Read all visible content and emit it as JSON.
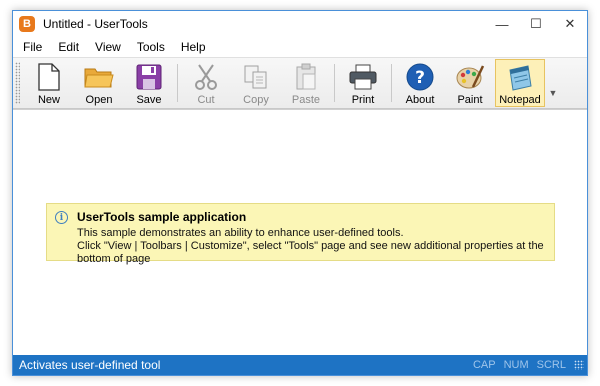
{
  "window": {
    "title": "Untitled - UserTools",
    "app_icon_letter": "B",
    "controls": {
      "minimize": "—",
      "maximize": "☐",
      "close": "✕"
    }
  },
  "menu": [
    "File",
    "Edit",
    "View",
    "Tools",
    "Help"
  ],
  "toolbar": {
    "new_label": "New",
    "open_label": "Open",
    "save_label": "Save",
    "cut_label": "Cut",
    "copy_label": "Copy",
    "paste_label": "Paste",
    "print_label": "Print",
    "about_label": "About",
    "paint_label": "Paint",
    "notepad_label": "Notepad",
    "active_item": "Notepad",
    "disabled_items": [
      "Cut",
      "Copy",
      "Paste"
    ]
  },
  "info": {
    "title": "UserTools sample application",
    "line1": "This sample demonstrates an ability to enhance user-defined tools.",
    "line2": "Click \"View | Toolbars | Customize\", select \"Tools\" page and see new additional properties at the bottom of page"
  },
  "status": {
    "text": "Activates user-defined tool",
    "cap": "CAP",
    "num": "NUM",
    "scrl": "SCRL"
  },
  "colors": {
    "statusbar": "#1e73c4",
    "info_background": "#fbf6b6",
    "active_button": "#fdf0b8",
    "window_border": "#4a90d9"
  }
}
